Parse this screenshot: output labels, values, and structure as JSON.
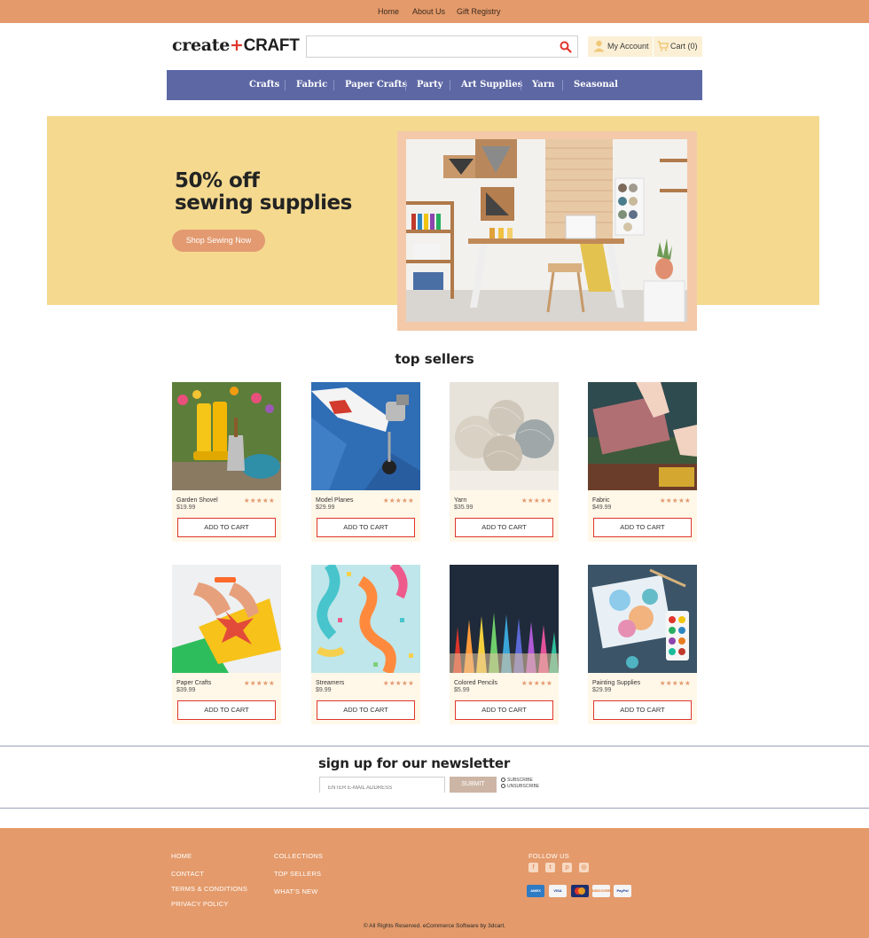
{
  "top_nav": {
    "home": "Home",
    "about": "About Us",
    "gift": "Gift Registry"
  },
  "header": {
    "logo_part1": "create",
    "logo_plus": "+",
    "logo_part2": "CRAFT",
    "search_value": "",
    "account_label": "My Account",
    "cart_label": "Cart (0)"
  },
  "categories": [
    "Crafts",
    "Fabric",
    "Paper Crafts",
    "Party",
    "Art Supplies",
    "Yarn",
    "Seasonal"
  ],
  "hero": {
    "line1": "50% off",
    "line2": "sewing supplies",
    "cta": "Shop Sewing Now"
  },
  "top_sellers": {
    "title": "top sellers",
    "add_label": "ADD TO CART",
    "stars": "★★★★★",
    "products": [
      {
        "name": "Garden Shovel",
        "price": "$19.99"
      },
      {
        "name": "Model Planes",
        "price": "$29.99"
      },
      {
        "name": "Yarn",
        "price": "$35.99"
      },
      {
        "name": "Fabric",
        "price": "$49.99"
      },
      {
        "name": "Paper Crafts",
        "price": "$39.99"
      },
      {
        "name": "Streamers",
        "price": "$9.99"
      },
      {
        "name": "Colored Pencils",
        "price": "$5.99"
      },
      {
        "name": "Painting Supplies",
        "price": "$29.99"
      }
    ]
  },
  "newsletter": {
    "title": "sign up for our newsletter",
    "placeholder": "ENTER E-MAIL ADDRESS",
    "submit": "SUBMIT",
    "subscribe": "SUBSCRIBE",
    "unsubscribe": "UNSUBSCRIBE"
  },
  "footer": {
    "col1": [
      "HOME",
      "CONTACT",
      "TERMS & CONDITIONS",
      "PRIVACY POLICY"
    ],
    "col2": [
      "COLLECTIONS",
      "TOP SELLERS",
      "WHAT'S NEW"
    ],
    "follow": "FOLLOW US",
    "social_icons": [
      "facebook-icon",
      "twitter-icon",
      "pinterest-icon",
      "instagram-icon"
    ],
    "payments": [
      "AMEX",
      "VISA",
      "",
      "DISCOVER",
      "PayPal"
    ],
    "copyright": "© All Rights Reserved. eCommerce Software by 3dcart."
  },
  "colors": {
    "topbar": "#e49a6a",
    "nav": "#5d67a4",
    "hero_bg": "#f4d98f",
    "accent_red": "#e0352b",
    "card_bg": "#fff7e8"
  }
}
